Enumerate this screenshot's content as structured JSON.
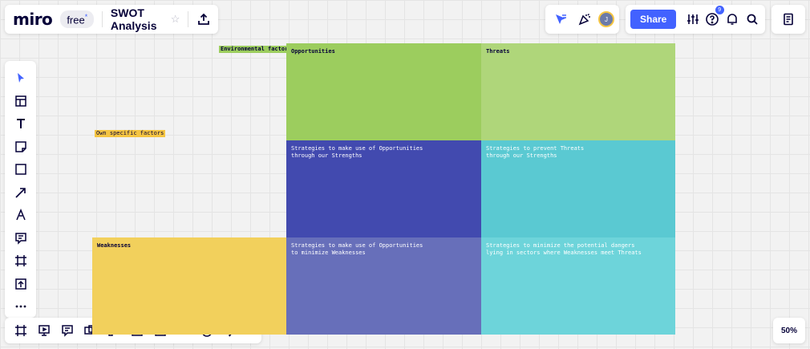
{
  "app": {
    "logo": "miro",
    "plan": "free",
    "plan_marker": "*",
    "board_title": "SWOT Analysis"
  },
  "header": {
    "share_label": "Share",
    "avatar_initial": "J",
    "help_badge_count": "9"
  },
  "zoom": "50%",
  "board": {
    "label_environmental": "Environmental factors",
    "label_own": "Own specific factors",
    "opportunities": "Opportunities",
    "threats": "Threats",
    "weaknesses": "Weaknesses",
    "so_text": "Strategies to make use of Opportunities\nthrough our Strengths",
    "st_text": "Strategies to prevent Threats\nthrough our Strengths",
    "wo_text": "Strategies to make use of Opportunities\nto minimize Weaknesses",
    "wt_text": "Strategies to minimize the potential dangers\nlying in sectors where Weaknesses meet Threats"
  },
  "colors": {
    "accent": "#4262ff",
    "opportunities": "#9ccd5e",
    "threats": "#afd67a",
    "so": "#424aaf",
    "st": "#5ac9d2",
    "weaknesses": "#f2d05c",
    "wo": "#676fba",
    "wt": "#6dd4da"
  },
  "toolbar_icons": [
    "select-icon",
    "templates-icon",
    "text-icon",
    "sticky-note-icon",
    "shape-icon",
    "arrow-icon",
    "pen-icon",
    "comment-icon",
    "frame-icon",
    "upload-icon",
    "more-icon"
  ],
  "bottom_icons": [
    "frames-icon",
    "presentation-icon",
    "comments-panel-icon",
    "video-chat-icon",
    "card-icon",
    "share-screen-icon",
    "embed-icon",
    "record-icon",
    "timer-icon",
    "power-icon"
  ]
}
